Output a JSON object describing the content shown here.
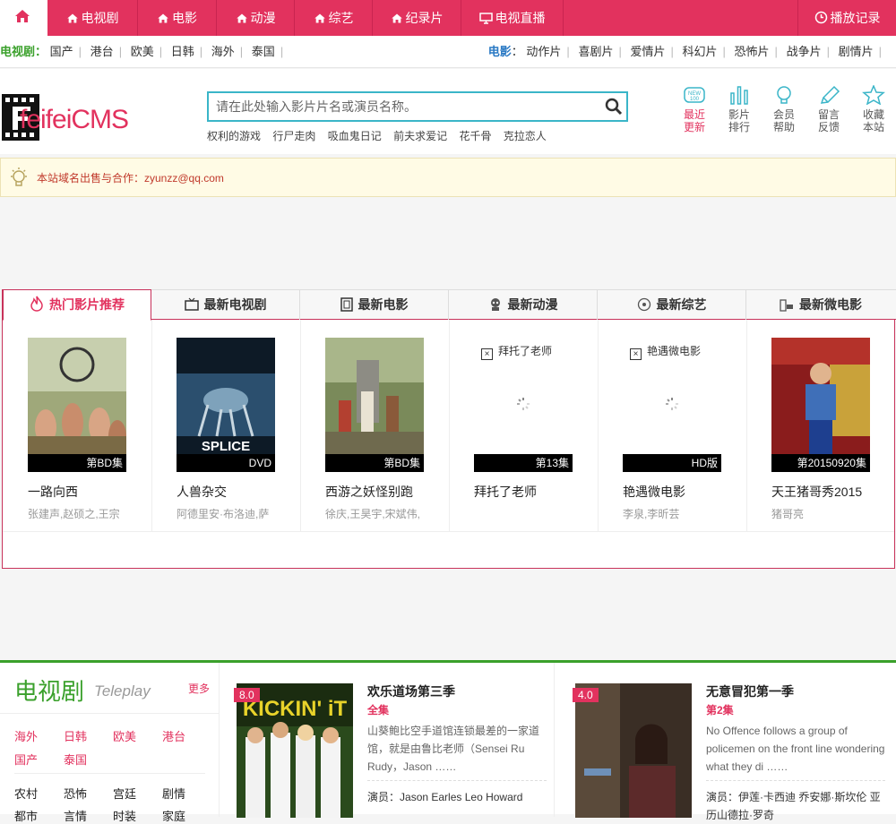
{
  "topnav": {
    "items": [
      "电视剧",
      "电影",
      "动漫",
      "综艺",
      "纪录片",
      "电视直播"
    ],
    "history": "播放记录"
  },
  "subnav": {
    "tv_label": "电视剧：",
    "tv_items": [
      "国产",
      "港台",
      "欧美",
      "日韩",
      "海外",
      "泰国"
    ],
    "movie_label": "电影",
    "movie_colon": "：",
    "movie_items": [
      "动作片",
      "喜剧片",
      "爱情片",
      "科幻片",
      "恐怖片",
      "战争片",
      "剧情片"
    ]
  },
  "logo": {
    "text": "feifeiCMS"
  },
  "search": {
    "placeholder": "请在此处输入影片片名或演员名称。"
  },
  "hotwords": [
    "权利的游戏",
    "行尸走肉",
    "吸血鬼日记",
    "前夫求爱记",
    "花千骨",
    "克拉恋人"
  ],
  "quick": [
    {
      "l1": "最近",
      "l2": "更新",
      "icon": "new-icon"
    },
    {
      "l1": "影片",
      "l2": "排行",
      "icon": "chart-icon"
    },
    {
      "l1": "会员",
      "l2": "帮助",
      "icon": "bulb-icon"
    },
    {
      "l1": "留言",
      "l2": "反馈",
      "icon": "pen-icon"
    },
    {
      "l1": "收藏",
      "l2": "本站",
      "icon": "star-icon"
    }
  ],
  "notice": "本站域名出售与合作：zyunzz@qq.com",
  "tabs": [
    "热门影片推荐",
    "最新电视剧",
    "最新电影",
    "最新动漫",
    "最新综艺",
    "最新微电影"
  ],
  "cards": [
    {
      "title": "一路向西",
      "cast": "张建声,赵硕之,王宗",
      "badge": "第BD集"
    },
    {
      "title": "人兽杂交",
      "cast": "阿德里安·布洛迪,萨",
      "badge": "DVD"
    },
    {
      "title": "西游之妖怪别跑",
      "cast": "徐庆,王昊宇,宋斌伟,",
      "badge": "第BD集"
    },
    {
      "title": "拜托了老师",
      "cast": "",
      "badge": "第13集",
      "alt": "拜托了老师"
    },
    {
      "title": "艳遇微电影",
      "cast": "李泉,李昕芸",
      "badge": "HD版",
      "alt": "艳遇微电影"
    },
    {
      "title": "天王猪哥秀2015",
      "cast": "猪哥亮",
      "badge": "第20150920集"
    }
  ],
  "tv": {
    "title": "电视剧",
    "en": "Teleplay",
    "more": "更多",
    "regions": [
      "海外",
      "日韩",
      "欧美",
      "港台",
      "国产",
      "泰国"
    ],
    "genres": [
      "农村",
      "恐怖",
      "宫廷",
      "剧情",
      "都市",
      "言情",
      "时装",
      "家庭"
    ]
  },
  "feat": [
    {
      "score": "8.0",
      "title": "欢乐道场第三季",
      "sub": "全集",
      "desc": "山葵鲍比空手道馆连锁最差的一家道馆，就是由鲁比老师（Sensei Ru Rudy，Jason ……",
      "cast_label": "演员：",
      "cast": "Jason  Earles  Leo  Howard",
      "poster_text": "KICKIN' iT"
    },
    {
      "score": "4.0",
      "title": "无意冒犯第一季",
      "sub": "第2集",
      "desc": "No Offence follows a group of policemen on the front line wondering what they di ……",
      "cast_label": "演员：",
      "cast": "伊莲·卡西迪    乔安娜·斯坎伦    亚历山德拉·罗奇"
    }
  ]
}
